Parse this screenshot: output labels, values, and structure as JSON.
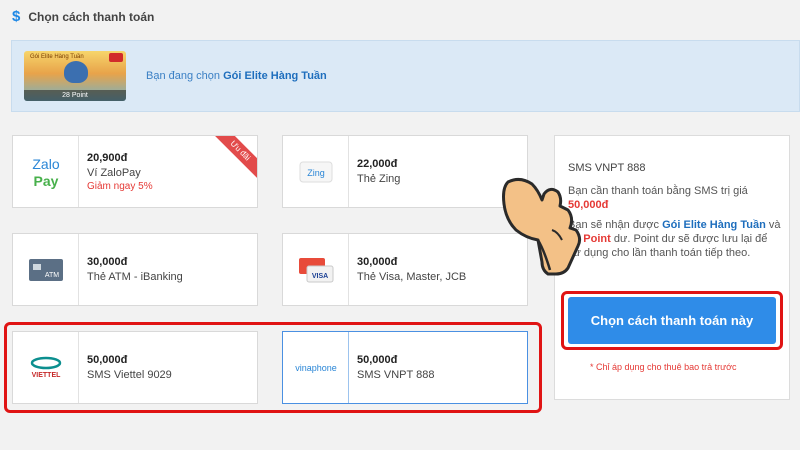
{
  "header": {
    "icon": "dollar-icon",
    "title": "Chọn cách thanh toán"
  },
  "banner": {
    "thumb_top": "Gói Elite Hàng Tuần",
    "thumb_point": "28 Point",
    "prefix": "Bạn đang chọn ",
    "package": "Gói Elite Hàng Tuần"
  },
  "methods": [
    {
      "price": "20,900đ",
      "name": "Ví ZaloPay",
      "promo": "Giảm ngay 5%",
      "ribbon": "Ưu đãi",
      "logo": "zalopay-logo"
    },
    {
      "price": "22,000đ",
      "name": "Thẻ Zing",
      "logo": "zing-logo"
    },
    {
      "price": "30,000đ",
      "name": "Thẻ ATM - iBanking",
      "logo": "atm-card-icon"
    },
    {
      "price": "30,000đ",
      "name": "Thẻ Visa, Master, JCB",
      "logo": "visa-master-icon"
    },
    {
      "price": "50,000đ",
      "name": "SMS Viettel 9029",
      "logo": "viettel-logo"
    },
    {
      "price": "50,000đ",
      "name": "SMS VNPT 888",
      "logo": "vinaphone-logo"
    }
  ],
  "logos": {
    "zalo_top": "Zalo",
    "zalo_bottom": "Pay",
    "zing": "Zing",
    "atm": "ATM",
    "visa": "VISA",
    "viettel": "VIETTEL",
    "vinaphone": "vinaphone"
  },
  "panel": {
    "title": "SMS VNPT 888",
    "line1": "Bạn cần thanh toán bằng SMS trị giá",
    "amount": "50,000đ",
    "line2_prefix": "Bạn sẽ nhận được ",
    "line2_package": "Gói Elite Hàng Tuần",
    "line2_mid": " và ",
    "line2_point": "28 Point",
    "line2_suffix": " dư. Point dư sẽ được lưu lại để sử dụng cho lần thanh toán tiếp theo."
  },
  "button": {
    "label": "Chọn cách thanh toán này"
  },
  "note": "* Chỉ áp dụng cho thuê bao trả trước",
  "colors": {
    "accent": "#2f8ce8",
    "highlight": "#e01414",
    "promo": "#e53935"
  }
}
